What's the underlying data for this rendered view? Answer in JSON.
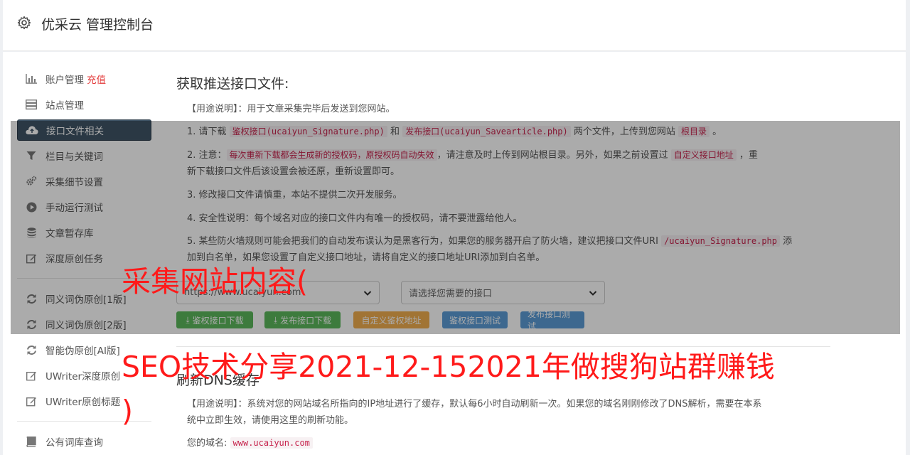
{
  "header": {
    "title": "优采云 管理控制台",
    "icon": "gear-icon"
  },
  "sidebar": {
    "items": [
      {
        "label": "账户管理",
        "accent": "充值",
        "icon": "bar-chart-icon"
      },
      {
        "label": "站点管理",
        "icon": "server-icon"
      },
      {
        "label": "接口文件相关",
        "icon": "cloud-upload-icon",
        "active": true
      },
      {
        "label": "栏目与关键词",
        "icon": "filter-icon"
      },
      {
        "label": "采集细节设置",
        "icon": "gears-icon"
      },
      {
        "label": "手动运行测试",
        "icon": "play-circle-icon"
      },
      {
        "label": "文章暂存库",
        "icon": "database-icon"
      },
      {
        "label": "深度原创任务",
        "icon": "edit-icon"
      },
      {
        "label": "同义词伪原创[1版]",
        "icon": "refresh-icon"
      },
      {
        "label": "同义词伪原创[2版]",
        "icon": "refresh-icon"
      },
      {
        "label": "智能伪原创[AI版]",
        "icon": "refresh-icon"
      },
      {
        "label": "UWriter深度原创",
        "icon": "edit-icon"
      },
      {
        "label": "UWriter原创标题",
        "icon": "edit-icon"
      },
      {
        "label": "公有词库查询",
        "icon": "book-icon"
      }
    ]
  },
  "main": {
    "section1_title": "获取推送接口文件:",
    "usage_label": "【用途说明】",
    "usage_text": "：用于文章采集完毕后发送到您网站。",
    "step1": {
      "a": "1. 请下载 ",
      "code1": "鉴权接口(ucaiyun_Signature.php)",
      "b": " 和 ",
      "code2": "发布接口(ucaiyun_Savearticle.php)",
      "c": " 两个文件，上传到您网站 ",
      "code3": "根目录",
      "d": " 。"
    },
    "step2": {
      "a": "2. 注意：",
      "code1": "每次重新下载都会生成新的授权码，原授权码自动失效",
      "b": "，请注意及时上传到网站根目录。另外，如果之前设置过 ",
      "code2": "自定义接口地址",
      "c": " ，重",
      "line2": "新下载接口文件后该设置会被还原，重新设置即可。"
    },
    "step3": "3. 修改接口文件请慎重，本站不提供二次开发服务。",
    "step4": "4. 安全性说明：每个域名对应的接口文件内有唯一的授权码，请不要泄露给他人。",
    "step5": {
      "a": "5. 某些防火墙规则可能会把我们的自动发布误认为是黑客行为，如果您的服务器开启了防火墙，建议把接口文件URI ",
      "code1": "/ucaiyun_Signature.php",
      "b": " 添",
      "line2": "加到白名单，如果您设置了自定义接口地址，请将自定义的接口地址URI添加到白名单。"
    },
    "site_select": "https://www.ucaiyun.com",
    "api_select": "请选择您需要的接口",
    "buttons": {
      "sig_download": "鉴权接口下载",
      "pub_download": "发布接口下载",
      "custom_addr": "自定义鉴权地址",
      "sig_test": "鉴权接口测试",
      "pub_test": "发布接口测试"
    },
    "section2_title": "刷新DNS缓存",
    "dns_usage_text1": "：系统对您的网站域名所指向的IP地址进行了缓存，默认每6小时自动刷新一次。如果您的域名刚刚修改了DNS解析，需要在本系",
    "dns_usage_text2": "统中立即生效，请使用这里的刷新功能。",
    "domain_label": "您的域名:",
    "domain_value": "www.ucaiyun.com"
  },
  "watermark": {
    "line1": "采集网站内容(",
    "line2": "SEO技术分享2021-12-152021年做搜狗站群赚钱",
    "line3": ")"
  }
}
